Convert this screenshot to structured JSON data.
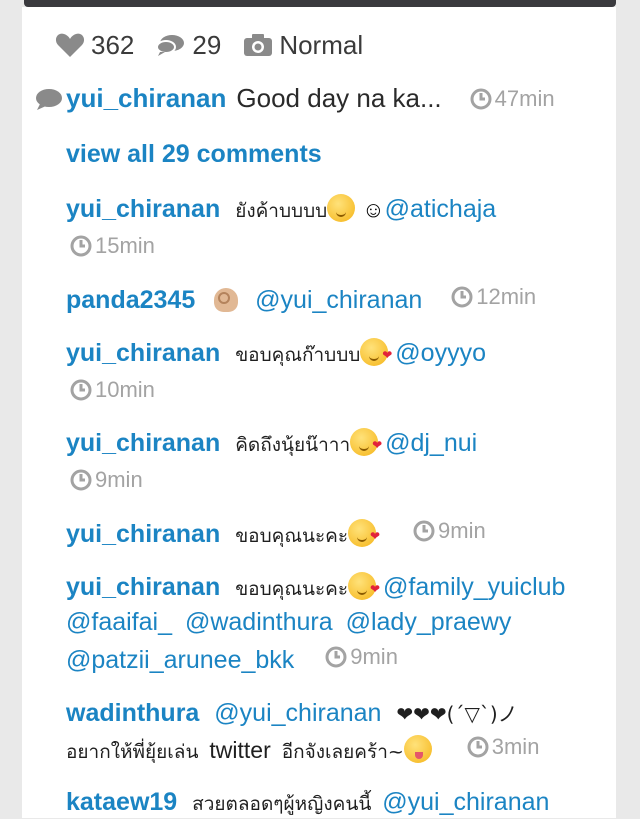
{
  "stats": {
    "likes": "362",
    "comments": "29",
    "filter": "Normal"
  },
  "caption": {
    "user": "yui_chiranan",
    "text": "Good day na ka...",
    "time": "47min"
  },
  "view_all": "view all 29 comments",
  "comments": [
    {
      "user": "yui_chiranan",
      "text": "ยังค้าบบบบ",
      "after": "☺",
      "mention": "@atichaja",
      "time": "15min"
    },
    {
      "user": "panda2345",
      "mention": "@yui_chiranan",
      "time": "12min"
    },
    {
      "user": "yui_chiranan",
      "text": "ขอบคุณก๊าบบบ",
      "mention": "@oyyyo",
      "time": "10min"
    },
    {
      "user": "yui_chiranan",
      "text": "คิดถึงนุ้ยน๊าาา",
      "mention": "@dj_nui",
      "time": "9min"
    },
    {
      "user": "yui_chiranan",
      "text": "ขอบคุณนะคะ",
      "time": "9min"
    },
    {
      "user": "yui_chiranan",
      "text": "ขอบคุณนะคะ",
      "mentions": [
        "@family_yuiclub",
        "@faaifai_",
        "@wadinthura",
        "@lady_praewy",
        "@patzii_arunee_bkk"
      ],
      "time": "9min"
    },
    {
      "user": "wadinthura",
      "mention": "@yui_chiranan",
      "text": "❤❤❤(´▽`)ノ",
      "text2": "อยากให้พี่ยุ้ยเล่น",
      "text3": "twitter",
      "text4": "อีกจังเลยคร้า~",
      "time": "3min"
    },
    {
      "user": "kataew19",
      "text": "สวยตลอดๆผู้หญิงคนนี้",
      "mention": "@yui_chiranan"
    }
  ],
  "icons": [
    "heart-icon",
    "comment-bubble-icon",
    "camera-icon",
    "clock-icon"
  ],
  "colors": {
    "link": "#1b84c3",
    "muted": "#a3a3a3",
    "text": "#3b3b3b"
  }
}
